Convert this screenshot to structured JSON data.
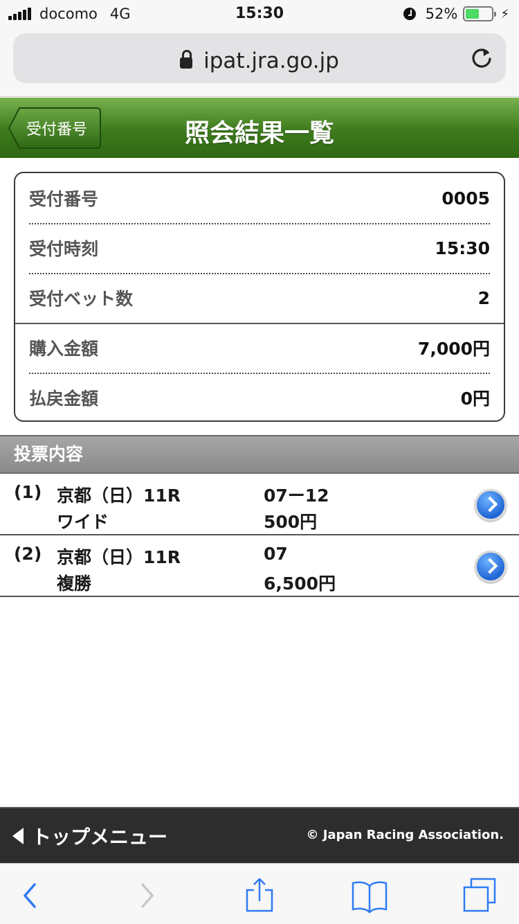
{
  "status_bar": {
    "carrier": "docomo",
    "network": "4G",
    "time": "15:30",
    "battery_percent": "52%",
    "battery_level": 0.52
  },
  "browser": {
    "url": "ipat.jra.go.jp"
  },
  "header": {
    "back_label": "受付番号",
    "title": "照会結果一覧"
  },
  "summary": {
    "rows": [
      {
        "label": "受付番号",
        "value": "0005"
      },
      {
        "label": "受付時刻",
        "value": "15:30"
      },
      {
        "label": "受付ベット数",
        "value": "2"
      },
      {
        "label": "購入金額",
        "value": "7,000円"
      },
      {
        "label": "払戻金額",
        "value": "0円"
      }
    ]
  },
  "section": {
    "title": "投票内容"
  },
  "bets": [
    {
      "index": "(1)",
      "race": "京都（日）11R",
      "type": "ワイド",
      "numbers": "07ー12",
      "amount": "500円"
    },
    {
      "index": "(2)",
      "race": "京都（日）11R",
      "type": "複勝",
      "numbers": "07",
      "amount": "6,500円"
    }
  ],
  "footer": {
    "top_menu_label": "トップメニュー",
    "copyright": "© Japan Racing Association."
  },
  "colors": {
    "header_green": "#3d7a1c",
    "accent_blue": "#1f66d6",
    "toolbar_blue": "#2f7bf5"
  }
}
